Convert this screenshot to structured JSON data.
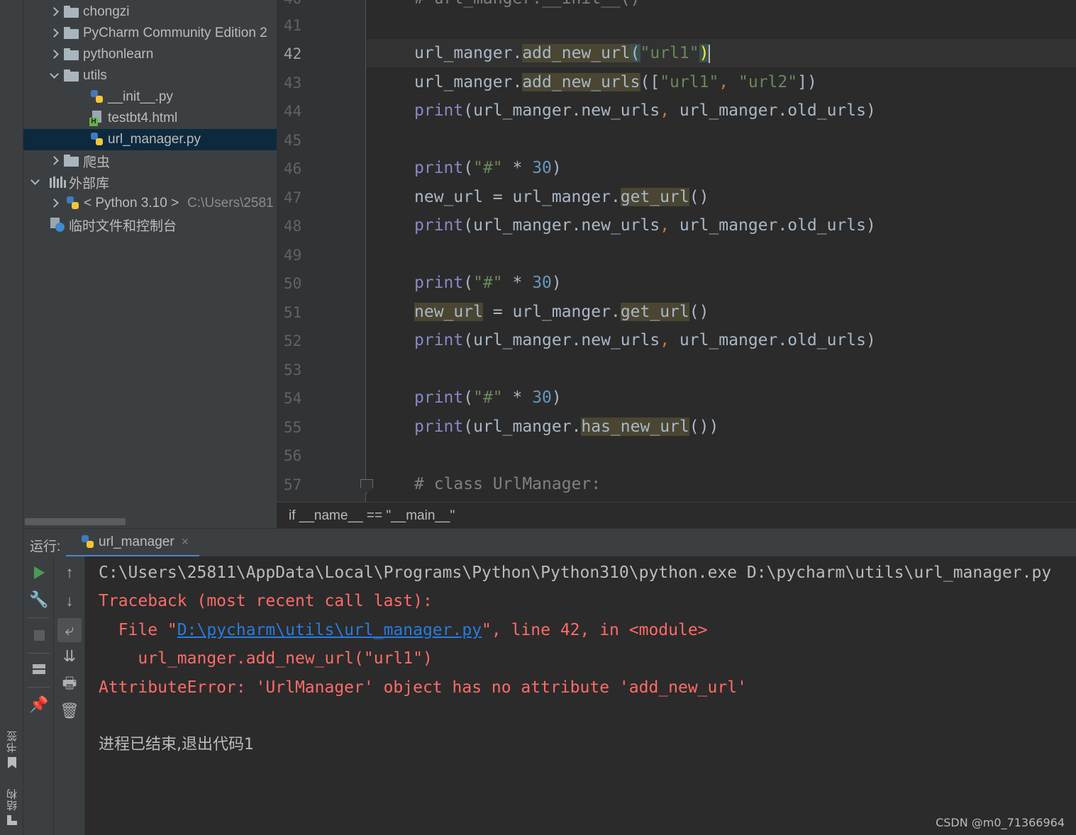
{
  "left_strip": {
    "bookmarks_label": "书签",
    "structure_label": "结构"
  },
  "project_tree": [
    {
      "label": "chongzi",
      "type": "folder",
      "state": "collapsed"
    },
    {
      "label": "PyCharm Community Edition 2",
      "type": "folder",
      "state": "collapsed"
    },
    {
      "label": "pythonlearn",
      "type": "folder",
      "state": "collapsed"
    },
    {
      "label": "utils",
      "type": "folder",
      "state": "expanded"
    },
    {
      "label": "__init__.py",
      "type": "python-file"
    },
    {
      "label": "testbt4.html",
      "type": "html-file"
    },
    {
      "label": "url_manager.py",
      "type": "python-file",
      "selected": true
    },
    {
      "label": "爬虫",
      "type": "folder",
      "state": "collapsed"
    },
    {
      "label": "外部库",
      "type": "library",
      "state": "expanded"
    },
    {
      "label": "< Python 3.10 >",
      "type": "python-sdk",
      "state": "collapsed",
      "path": "C:\\Users\\2581"
    },
    {
      "label": "临时文件和控制台",
      "type": "scratches"
    }
  ],
  "editor": {
    "line_numbers": [
      "41",
      "42",
      "43",
      "44",
      "45",
      "46",
      "47",
      "48",
      "49",
      "50",
      "51",
      "52",
      "53",
      "54",
      "55",
      "56",
      "57"
    ],
    "current_line": "42",
    "lines": {
      "l42": {
        "a": "url_manger.",
        "b": "add_new_url",
        "c": "(",
        "d": "\"url1\"",
        "e": ")"
      },
      "l43": {
        "a": "url_manger.",
        "b": "add_new_urls",
        "c": "([",
        "d": "\"url1\"",
        "e": ", ",
        "f": "\"url2\"",
        "g": "])"
      },
      "l44": {
        "a": "print",
        "b": "(url_manger.new_urls",
        "c": ", ",
        "d": "url_manger.old_urls)"
      },
      "l46": {
        "a": "print",
        "b": "(",
        "c": "\"#\"",
        "d": " * ",
        "e": "30",
        "f": ")"
      },
      "l47": {
        "a": "new_url = url_manger.",
        "b": "get_url",
        "c": "()"
      },
      "l48": {
        "a": "print",
        "b": "(url_manger.new_urls",
        "c": ", ",
        "d": "url_manger.old_urls)"
      },
      "l50": {
        "a": "print",
        "b": "(",
        "c": "\"#\"",
        "d": " * ",
        "e": "30",
        "f": ")"
      },
      "l51": {
        "a": "new_url",
        "b": " = url_manger.",
        "c": "get_url",
        "d": "()"
      },
      "l52": {
        "a": "print",
        "b": "(url_manger.new_urls",
        "c": ", ",
        "d": "url_manger.old_urls)"
      },
      "l54": {
        "a": "print",
        "b": "(",
        "c": "\"#\"",
        "d": " * ",
        "e": "30",
        "f": ")"
      },
      "l55": {
        "a": "print",
        "b": "(url_manger.",
        "c": "has_new_url",
        "d": "())"
      },
      "l57": {
        "a": "# class UrlManager:"
      }
    },
    "breadcrumb": "if __name__ == \"__main__\""
  },
  "run_panel": {
    "title": "运行:",
    "tab_label": "url_manager",
    "tab_close": "×",
    "console": {
      "command": "C:\\Users\\25811\\AppData\\Local\\Programs\\Python\\Python310\\python.exe D:\\pycharm\\utils\\url_manager.py",
      "traceback_header": "Traceback (most recent call last):",
      "file_prefix": "  File \"",
      "file_link": "D:\\pycharm\\utils\\url_manager.py",
      "file_suffix": "\", line 42, in <module>",
      "code_line": "    url_manger.add_new_url(\"url1\")",
      "error": "AttributeError: 'UrlManager' object has no attribute 'add_new_url'",
      "exit_message": "进程已结束,退出代码1"
    }
  },
  "watermark": "CSDN @m0_71366964",
  "colors": {
    "error": "#ff6b68",
    "link": "#287bde",
    "run_green": "#499c54",
    "selection": "#0d293e"
  }
}
